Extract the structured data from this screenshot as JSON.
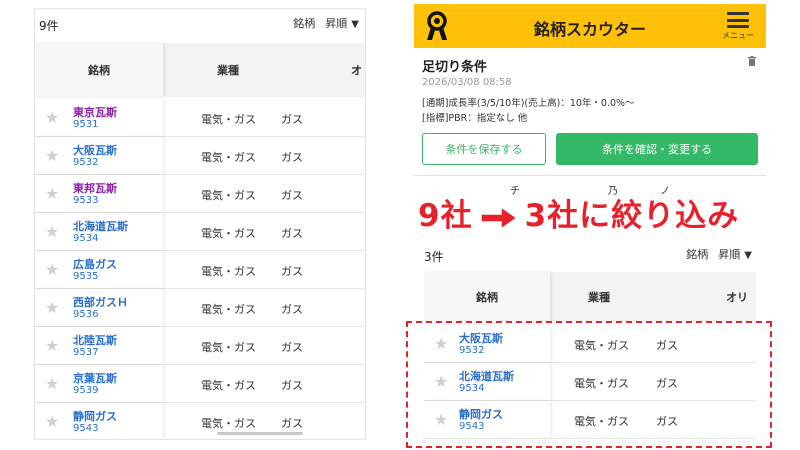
{
  "colors": {
    "accent_yellow": "#ffc107",
    "green": "#33b968",
    "red": "#e8202a",
    "link_purple": "#8b1fa8",
    "link_blue": "#2a6fc9"
  },
  "left": {
    "count": "9件",
    "sort": {
      "field": "銘柄",
      "order": "昇順"
    },
    "columns": [
      "銘柄",
      "業種",
      "オ"
    ],
    "rows": [
      {
        "name": "東京瓦斯",
        "code": "9531",
        "industry": "電気・ガス",
        "sub": "ガス",
        "visited": true
      },
      {
        "name": "大阪瓦斯",
        "code": "9532",
        "industry": "電気・ガス",
        "sub": "ガス",
        "visited": false
      },
      {
        "name": "東邦瓦斯",
        "code": "9533",
        "industry": "電気・ガス",
        "sub": "ガス",
        "visited": true
      },
      {
        "name": "北海道瓦斯",
        "code": "9534",
        "industry": "電気・ガス",
        "sub": "ガス",
        "visited": false
      },
      {
        "name": "広島ガス",
        "code": "9535",
        "industry": "電気・ガス",
        "sub": "ガス",
        "visited": false
      },
      {
        "name": "西部ガスＨ",
        "code": "9536",
        "industry": "電気・ガス",
        "sub": "ガス",
        "visited": false
      },
      {
        "name": "北陸瓦斯",
        "code": "9537",
        "industry": "電気・ガス",
        "sub": "ガス",
        "visited": false
      },
      {
        "name": "京葉瓦斯",
        "code": "9539",
        "industry": "電気・ガス",
        "sub": "ガス",
        "visited": false
      },
      {
        "name": "静岡ガス",
        "code": "9543",
        "industry": "電気・ガス",
        "sub": "ガス",
        "visited": false
      }
    ]
  },
  "right": {
    "app_title": "銘柄スカウター",
    "menu_label": "メニュー",
    "cut_title": "足切り条件",
    "cut_date": "2026/03/08 08:58",
    "cond_line1": "[通期]成長率(3/5/10年)(売上高)：10年・0.0%〜",
    "cond_line2": "[指標]PBR：指定なし 他",
    "save_button": "条件を保存する",
    "confirm_button": "条件を確認・変更する",
    "hidden_fragments": [
      "チ",
      "乃",
      "ノ"
    ],
    "banner_left": "9社",
    "banner_right": "3社に絞り込み",
    "count": "3件",
    "sort": {
      "field": "銘柄",
      "order": "昇順"
    },
    "columns": [
      "銘柄",
      "業種",
      "オリ"
    ],
    "rows": [
      {
        "name": "大阪瓦斯",
        "code": "9532",
        "industry": "電気・ガス",
        "sub": "ガス"
      },
      {
        "name": "北海道瓦斯",
        "code": "9534",
        "industry": "電気・ガス",
        "sub": "ガス"
      },
      {
        "name": "静岡ガス",
        "code": "9543",
        "industry": "電気・ガス",
        "sub": "ガス"
      }
    ]
  }
}
